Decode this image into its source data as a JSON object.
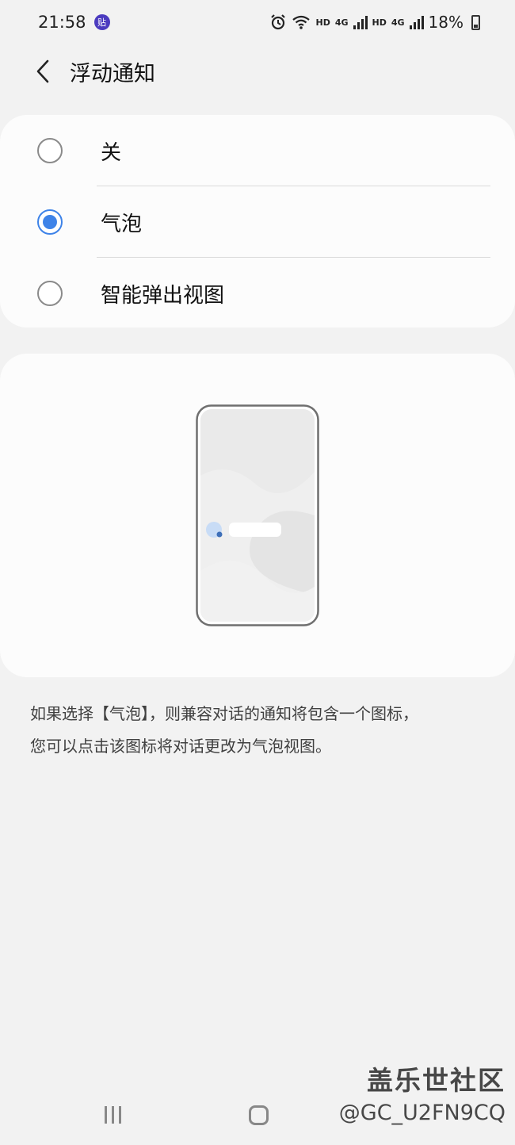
{
  "status_bar": {
    "time": "21:58",
    "app_badge": "贴",
    "hd1": "HD",
    "net1": "4G",
    "hd2": "HD",
    "net2": "4G",
    "battery": "18%",
    "icons": [
      "alarm-icon",
      "wifi-icon",
      "signal-icon",
      "battery-icon"
    ]
  },
  "header": {
    "title": "浮动通知",
    "back_icon": "chevron-left-icon"
  },
  "options": [
    {
      "label": "关",
      "checked": false
    },
    {
      "label": "气泡",
      "checked": true
    },
    {
      "label": "智能弹出视图",
      "checked": false
    }
  ],
  "description": {
    "line1": "如果选择【气泡】，则兼容对话的通知将包含一个图标，",
    "line2": "您可以点击该图标将对话更改为气泡视图。"
  },
  "watermark": {
    "line1": "盖乐世社区",
    "line2": "@GC_U2FN9CQ"
  },
  "colors": {
    "accent": "#3e83e8",
    "background": "#f2f2f2",
    "card": "#fcfcfc"
  }
}
